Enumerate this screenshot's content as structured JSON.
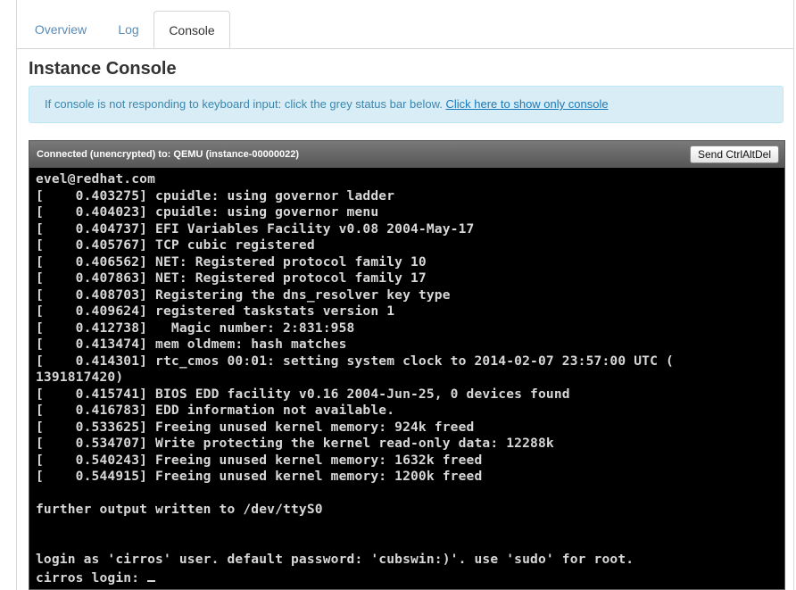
{
  "tabs": [
    {
      "label": "Overview",
      "active": false
    },
    {
      "label": "Log",
      "active": false
    },
    {
      "label": "Console",
      "active": true
    }
  ],
  "page": {
    "title": "Instance Console"
  },
  "info": {
    "text": "If console is not responding to keyboard input: click the grey status bar below. ",
    "link": "Click here to show only console"
  },
  "console": {
    "status": "Connected (unencrypted) to: QEMU (instance-00000022)",
    "send_button": "Send CtrlAltDel",
    "lines": [
      "evel@redhat.com",
      "[    0.403275] cpuidle: using governor ladder",
      "[    0.404023] cpuidle: using governor menu",
      "[    0.404737] EFI Variables Facility v0.08 2004-May-17",
      "[    0.405767] TCP cubic registered",
      "[    0.406562] NET: Registered protocol family 10",
      "[    0.407863] NET: Registered protocol family 17",
      "[    0.408703] Registering the dns_resolver key type",
      "[    0.409624] registered taskstats version 1",
      "[    0.412738]   Magic number: 2:831:958",
      "[    0.413474] mem oldmem: hash matches",
      "[    0.414301] rtc_cmos 00:01: setting system clock to 2014-02-07 23:57:00 UTC (",
      "1391817420)",
      "[    0.415741] BIOS EDD facility v0.16 2004-Jun-25, 0 devices found",
      "[    0.416783] EDD information not available.",
      "[    0.533625] Freeing unused kernel memory: 924k freed",
      "[    0.534707] Write protecting the kernel read-only data: 12288k",
      "[    0.540243] Freeing unused kernel memory: 1632k freed",
      "[    0.544915] Freeing unused kernel memory: 1200k freed",
      "",
      "further output written to /dev/ttyS0",
      "",
      "",
      "login as 'cirros' user. default password: 'cubswin:)'. use 'sudo' for root.",
      "cirros login: "
    ]
  }
}
